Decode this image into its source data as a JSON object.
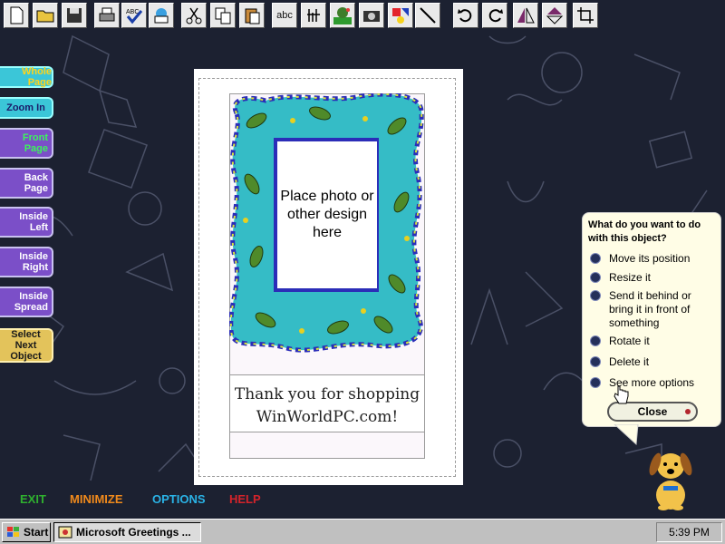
{
  "toolbar": {
    "buttons": [
      {
        "name": "new-icon"
      },
      {
        "name": "open-folder-icon"
      },
      {
        "name": "save-disk-icon"
      },
      {
        "name": "print-icon"
      },
      {
        "name": "spell-check-icon",
        "label": "ABC"
      },
      {
        "name": "send-mail-icon"
      },
      {
        "name": "cut-icon"
      },
      {
        "name": "copy-icon"
      },
      {
        "name": "paste-icon"
      },
      {
        "name": "text-icon",
        "label": "abc"
      },
      {
        "name": "word-art-icon"
      },
      {
        "name": "picture-icon"
      },
      {
        "name": "camera-icon"
      },
      {
        "name": "shapes-icon"
      },
      {
        "name": "line-icon"
      },
      {
        "name": "undo-icon"
      },
      {
        "name": "redo-icon"
      },
      {
        "name": "flip-icon"
      },
      {
        "name": "flip-vertical-icon"
      },
      {
        "name": "crop-icon"
      }
    ]
  },
  "sidebar": {
    "items": [
      {
        "label": "Whole Page"
      },
      {
        "label": "Zoom In"
      },
      {
        "label": "Front Page"
      },
      {
        "label": "Back Page"
      },
      {
        "label": "Inside Left"
      },
      {
        "label": "Inside Right"
      },
      {
        "label": "Inside Spread"
      },
      {
        "label": "Select Next Object"
      }
    ]
  },
  "card": {
    "placeholder": "Place photo or other design here",
    "message_line1": "Thank you for shopping",
    "message_line2": "WinWorldPC.com!"
  },
  "bottom_menu": {
    "exit": "EXIT",
    "minimize": "MINIMIZE",
    "options": "OPTIONS",
    "help": "HELP"
  },
  "help_bubble": {
    "question": "What do you want to do with this object?",
    "options": [
      "Move its position",
      "Resize it",
      "Send it behind or bring it in front of something",
      "Rotate it",
      "Delete it",
      "See more options"
    ],
    "close_label": "Close"
  },
  "taskbar": {
    "start_label": "Start",
    "task_label": "Microsoft Greetings ...",
    "clock": "5:39 PM"
  },
  "colors": {
    "exit": "#2fb02f",
    "minimize": "#f08a1c",
    "options": "#2ab3e6",
    "help": "#d4232a"
  }
}
